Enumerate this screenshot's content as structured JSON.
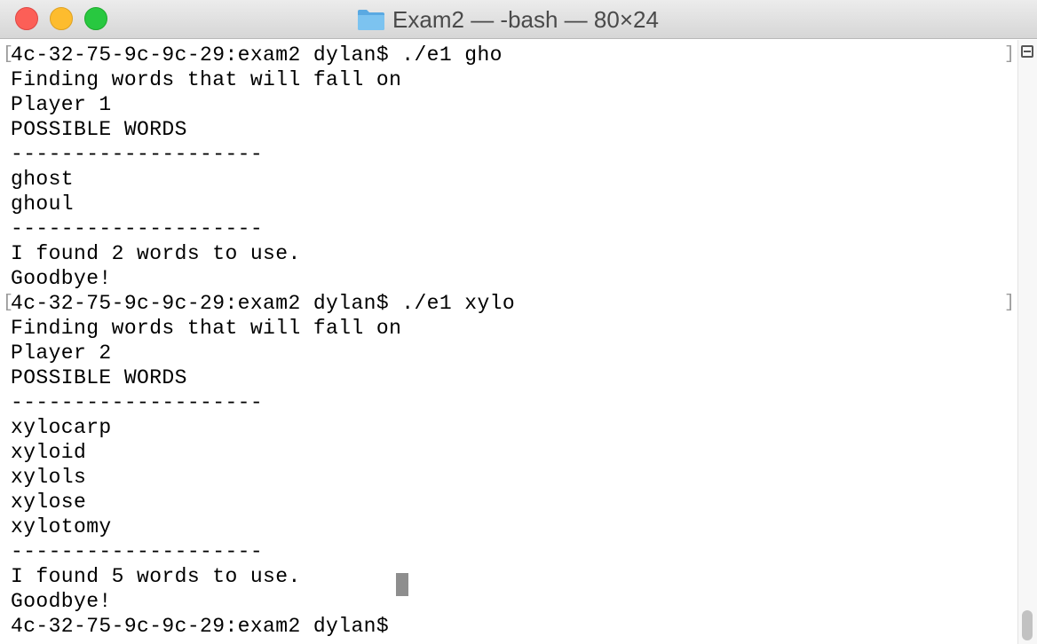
{
  "window": {
    "title": "Exam2 — -bash — 80×24",
    "icon": "folder-icon",
    "colors": {
      "close": "#fc5f57",
      "minimize": "#fdbc2e",
      "zoom": "#28c840",
      "folder": "#6fb7ea",
      "text": "#000000",
      "cursor": "#8e8e8e"
    }
  },
  "terminal": {
    "lines": [
      "4c-32-75-9c-9c-29:exam2 dylan$ ./e1 gho",
      "Finding words that will fall on",
      "Player 1",
      "POSSIBLE WORDS",
      "--------------------",
      "ghost",
      "ghoul",
      "--------------------",
      "I found 2 words to use.",
      "Goodbye!",
      "4c-32-75-9c-9c-29:exam2 dylan$ ./e1 xylo",
      "Finding words that will fall on",
      "Player 2",
      "POSSIBLE WORDS",
      "--------------------",
      "xylocarp",
      "xyloid",
      "xylols",
      "xylose",
      "xylotomy",
      "--------------------",
      "I found 5 words to use.",
      "Goodbye!",
      "4c-32-75-9c-9c-29:exam2 dylan$ "
    ]
  }
}
